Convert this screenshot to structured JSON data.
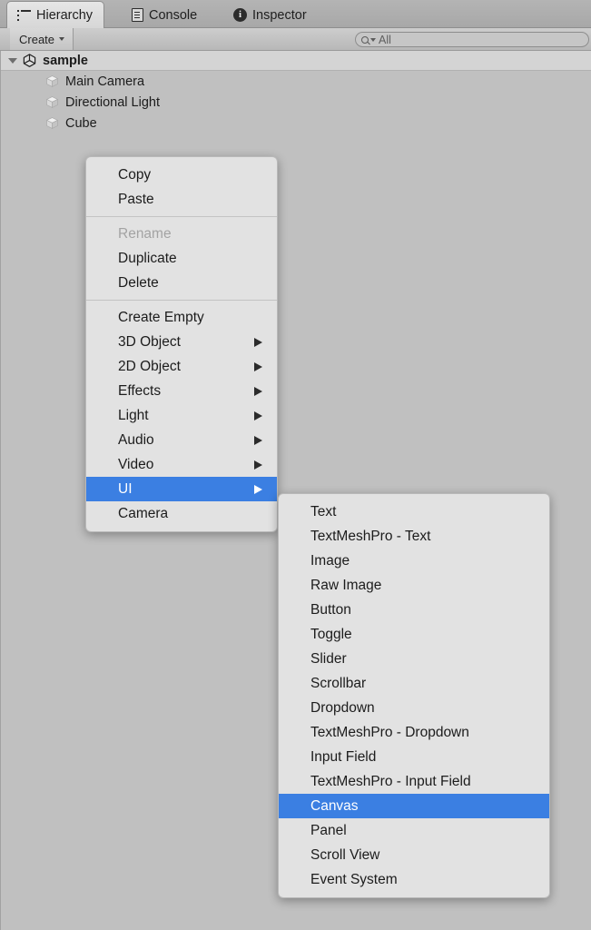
{
  "window": {
    "tabs": [
      {
        "label": "Hierarchy",
        "icon": "list-icon",
        "active": true
      },
      {
        "label": "Console",
        "icon": "document-icon",
        "active": false
      },
      {
        "label": "Inspector",
        "icon": "info-icon",
        "active": false
      }
    ]
  },
  "toolbar": {
    "create_label": "Create",
    "create_caret": "▾",
    "search_value": "All",
    "search_placeholder": "All",
    "search_icon": "magnifier-dropdown-icon"
  },
  "hierarchy": {
    "scene": {
      "label": "sample",
      "icon": "unity-logo-icon",
      "expanded": true
    },
    "children": [
      {
        "label": "Main Camera",
        "icon": "gameobject-cube-icon"
      },
      {
        "label": "Directional Light",
        "icon": "gameobject-cube-icon"
      },
      {
        "label": "Cube",
        "icon": "gameobject-cube-icon"
      }
    ]
  },
  "context_menu": {
    "groups": [
      [
        {
          "label": "Copy",
          "state": "enabled",
          "submenu": false
        },
        {
          "label": "Paste",
          "state": "enabled",
          "submenu": false
        }
      ],
      [
        {
          "label": "Rename",
          "state": "disabled",
          "submenu": false
        },
        {
          "label": "Duplicate",
          "state": "enabled",
          "submenu": false
        },
        {
          "label": "Delete",
          "state": "enabled",
          "submenu": false
        }
      ],
      [
        {
          "label": "Create Empty",
          "state": "enabled",
          "submenu": false
        },
        {
          "label": "3D Object",
          "state": "enabled",
          "submenu": true
        },
        {
          "label": "2D Object",
          "state": "enabled",
          "submenu": true
        },
        {
          "label": "Effects",
          "state": "enabled",
          "submenu": true
        },
        {
          "label": "Light",
          "state": "enabled",
          "submenu": true
        },
        {
          "label": "Audio",
          "state": "enabled",
          "submenu": true
        },
        {
          "label": "Video",
          "state": "enabled",
          "submenu": true
        },
        {
          "label": "UI",
          "state": "selected",
          "submenu": true
        },
        {
          "label": "Camera",
          "state": "enabled",
          "submenu": false
        }
      ]
    ]
  },
  "ui_submenu": {
    "items": [
      {
        "label": "Text",
        "state": "enabled"
      },
      {
        "label": "TextMeshPro - Text",
        "state": "enabled"
      },
      {
        "label": "Image",
        "state": "enabled"
      },
      {
        "label": "Raw Image",
        "state": "enabled"
      },
      {
        "label": "Button",
        "state": "enabled"
      },
      {
        "label": "Toggle",
        "state": "enabled"
      },
      {
        "label": "Slider",
        "state": "enabled"
      },
      {
        "label": "Scrollbar",
        "state": "enabled"
      },
      {
        "label": "Dropdown",
        "state": "enabled"
      },
      {
        "label": "TextMeshPro - Dropdown",
        "state": "enabled"
      },
      {
        "label": "Input Field",
        "state": "enabled"
      },
      {
        "label": "TextMeshPro - Input Field",
        "state": "enabled"
      },
      {
        "label": "Canvas",
        "state": "selected"
      },
      {
        "label": "Panel",
        "state": "enabled"
      },
      {
        "label": "Scroll View",
        "state": "enabled"
      },
      {
        "label": "Event System",
        "state": "enabled"
      }
    ]
  },
  "colors": {
    "highlight": "#3b7fe2",
    "menu_bg": "#e2e2e2",
    "panel_bg": "#c0c0c0",
    "scene_row_bg": "#d4d4d4",
    "text": "#1c1c1c",
    "text_disabled": "#a3a3a3"
  }
}
